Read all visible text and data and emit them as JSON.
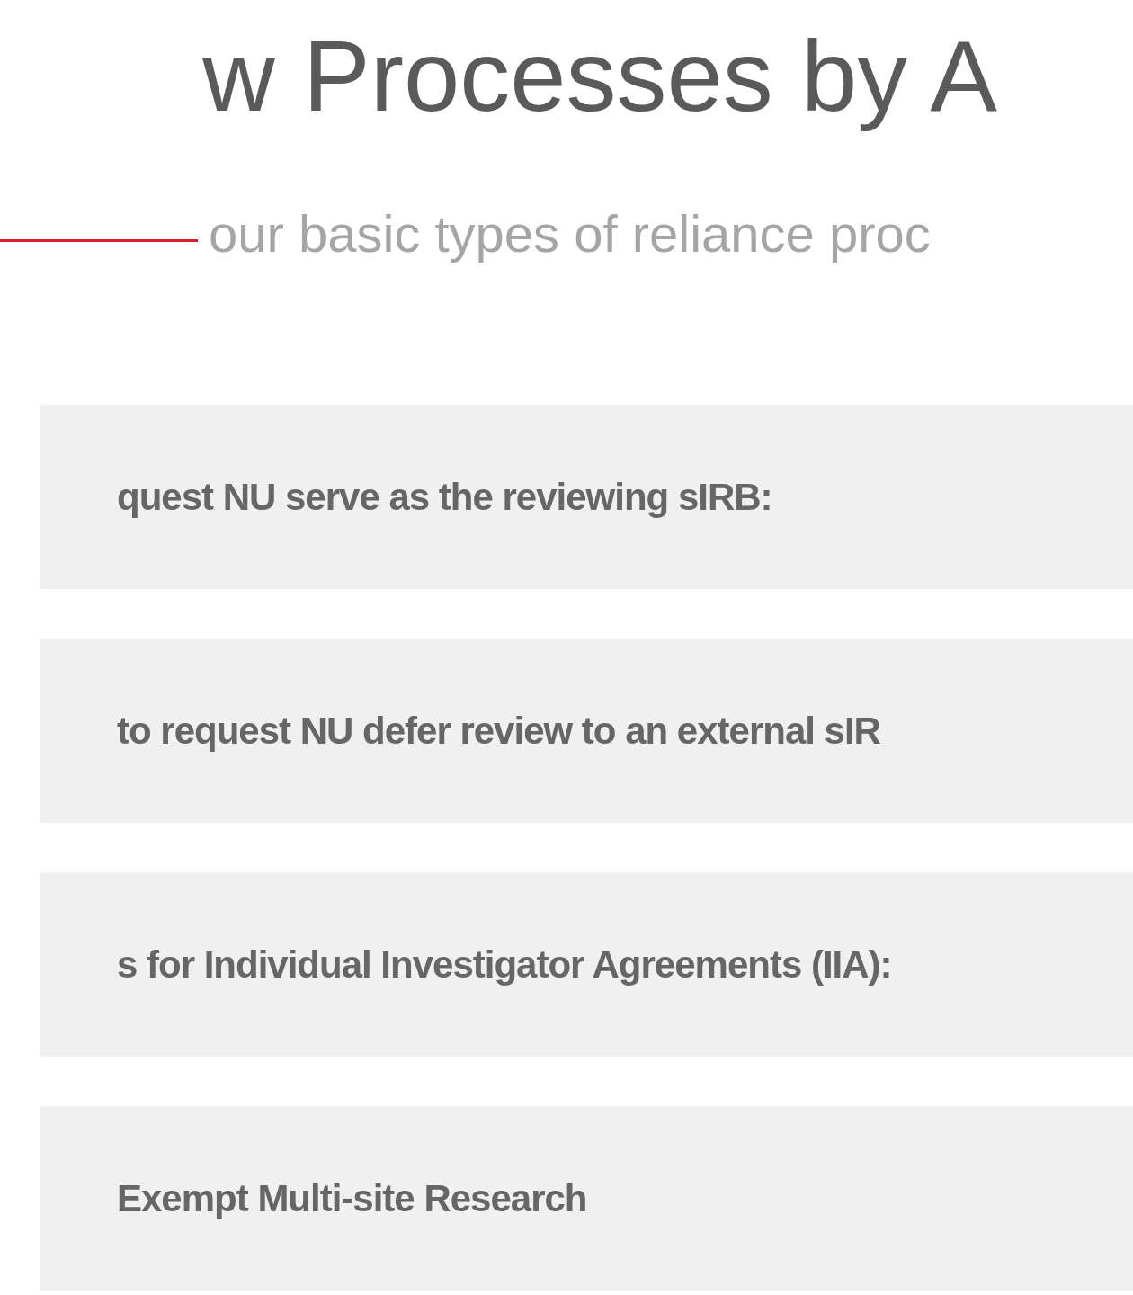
{
  "heading": {
    "title": "w Processes by A",
    "subtitle": "our basic types of reliance proc"
  },
  "accordion": [
    {
      "label": "quest NU serve as the reviewing sIRB:"
    },
    {
      "label": "to request NU defer review to an external sIR"
    },
    {
      "label": "s for Individual Investigator Agreements (IIA):"
    },
    {
      "label": "Exempt Multi-site Research"
    }
  ]
}
